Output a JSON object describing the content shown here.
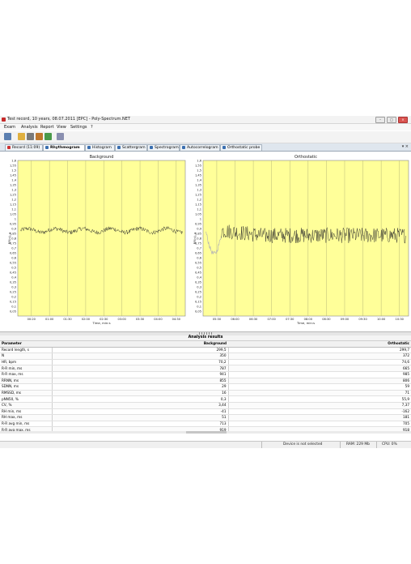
{
  "window": {
    "title": "Test record, 10 years, 08.07.2011 [EPC] - Poly-Spectrum.NET",
    "buttons": [
      "–",
      "□",
      "×"
    ]
  },
  "menu": [
    "Exam",
    "Analysis",
    "Report",
    "View",
    "Settings",
    "?"
  ],
  "toolbar_icons": [
    "save-icon",
    "open-icon",
    "print-icon",
    "export-icon",
    "chart-icon",
    "settings-icon"
  ],
  "tabs": [
    {
      "label": "Record (11:09)",
      "active": false
    },
    {
      "label": "Rhythmogram",
      "active": true
    },
    {
      "label": "Histogram",
      "active": false
    },
    {
      "label": "Scattergram",
      "active": false
    },
    {
      "label": "Spectrogram",
      "active": false
    },
    {
      "label": "Autocorrelogram",
      "active": false
    },
    {
      "label": "Orthostatic probe",
      "active": false
    }
  ],
  "tab_controls": "▾ ×",
  "chart_data": [
    {
      "type": "line",
      "title": "Background",
      "xlabel": "Time, min:s",
      "ylabel": "RR(s), s",
      "yticks": [
        "1,6",
        "1,55",
        "1,5",
        "1,45",
        "1,4",
        "1,35",
        "1,3",
        "1,25",
        "1,2",
        "1,15",
        "1,1",
        "1,05",
        "1",
        "0,95",
        "0,9",
        "0,85",
        "0,8",
        "0,75",
        "0,7",
        "0,65",
        "0,6",
        "0,55",
        "0,5",
        "0,45",
        "0,4",
        "0,35",
        "0,3",
        "0,25",
        "0,2",
        "0,15",
        "0,1",
        "0,05"
      ],
      "xticks": [
        "00:20",
        "01:00",
        "01:30",
        "02:00",
        "02:30",
        "03:00",
        "03:30",
        "04:00",
        "04:30"
      ],
      "ylim": [
        0,
        1.6
      ],
      "xlim": [
        0,
        300
      ],
      "grid": true,
      "series": [
        {
          "values_summary": {
            "mean": 0.88,
            "min": 0.84,
            "max": 0.93,
            "n_beats": 330
          }
        }
      ]
    },
    {
      "type": "line",
      "title": "Orthostatic",
      "xlabel": "Time, min:s",
      "ylabel": "RR(s), s",
      "yticks": [
        "1,6",
        "1,55",
        "1,5",
        "1,45",
        "1,4",
        "1,35",
        "1,3",
        "1,25",
        "1,2",
        "1,15",
        "1,1",
        "1,05",
        "1",
        "0,95",
        "0,9",
        "0,85",
        "0,8",
        "0,75",
        "0,7",
        "0,65",
        "0,6",
        "0,55",
        "0,5",
        "0,45",
        "0,4",
        "0,35",
        "0,3",
        "0,25",
        "0,2",
        "0,15",
        "0,1",
        "0,05"
      ],
      "xticks": [
        "05:30",
        "06:00",
        "06:30",
        "07:00",
        "07:30",
        "08:00",
        "08:30",
        "09:00",
        "09:30",
        "10:00",
        "10:30"
      ],
      "ylim": [
        0,
        1.6
      ],
      "xlim": [
        310,
        660
      ],
      "grid": true,
      "series": [
        {
          "values_summary": {
            "mean": 0.84,
            "min": 0.62,
            "max": 0.98,
            "n_beats": 372
          }
        }
      ]
    }
  ],
  "results": {
    "title": "Analysis results",
    "headers": [
      "Parameter",
      "Background",
      "Orthostatic"
    ],
    "rows": [
      [
        "Record length, s",
        "299,5",
        "299,7"
      ],
      [
        "N",
        "350",
        "372"
      ],
      [
        "HR, bpm",
        "70,2",
        "74,6"
      ],
      [
        "R-R min, ms",
        "787",
        "665"
      ],
      [
        "R-R max, ms",
        "941",
        "985"
      ],
      [
        "RRNN, ms",
        "855",
        "806"
      ],
      [
        "SDNN, ms",
        "29",
        "59"
      ],
      [
        "RMSSD, ms",
        "16",
        "71"
      ],
      [
        "pNN50, %",
        "0,3",
        "55,9"
      ],
      [
        "CV, %",
        "3,44",
        "7,37"
      ],
      [
        "RH min, ms",
        "-41",
        "-162"
      ],
      [
        "RH max, ms",
        "51",
        "181"
      ],
      [
        "R-R avg min, ms",
        "713",
        "705"
      ],
      [
        "R-R avg max, ms",
        "919",
        "918"
      ]
    ]
  },
  "status": {
    "device": "Device is not selected",
    "ram": "RAM: 229 Mb",
    "cpu": "CPU: 0%"
  },
  "colors": {
    "plot_bg": "#ffff99",
    "grid": "#b9b97a",
    "trace": "#2a2a2a",
    "trace_light": "#b5b5b5"
  }
}
